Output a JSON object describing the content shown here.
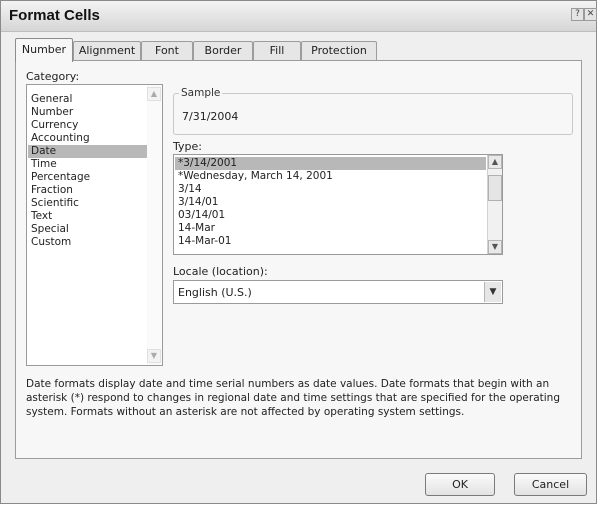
{
  "window": {
    "title": "Format Cells",
    "help_glyph": "?",
    "close_glyph": "✕"
  },
  "tabs": [
    {
      "label": "Number",
      "active": true
    },
    {
      "label": "Alignment",
      "active": false
    },
    {
      "label": "Font",
      "active": false
    },
    {
      "label": "Border",
      "active": false
    },
    {
      "label": "Fill",
      "active": false
    },
    {
      "label": "Protection",
      "active": false
    }
  ],
  "category": {
    "label": "Category:",
    "items": [
      "General",
      "Number",
      "Currency",
      "Accounting",
      "Date",
      "Time",
      "Percentage",
      "Fraction",
      "Scientific",
      "Text",
      "Special",
      "Custom"
    ],
    "selected": "Date"
  },
  "sample": {
    "label": "Sample",
    "value": "7/31/2004"
  },
  "type": {
    "label": "Type:",
    "items": [
      "*3/14/2001",
      "*Wednesday, March 14, 2001",
      "3/14",
      "3/14/01",
      "03/14/01",
      "14-Mar",
      "14-Mar-01"
    ],
    "selected": "*3/14/2001"
  },
  "locale": {
    "label": "Locale (location):",
    "value": "English (U.S.)"
  },
  "description": "Date formats display date and time serial numbers as date values.  Date formats that begin with an asterisk (*) respond to changes in regional date and time settings that are specified for the operating system. Formats without an asterisk are not affected by operating system settings.",
  "buttons": {
    "ok": "OK",
    "cancel": "Cancel"
  }
}
